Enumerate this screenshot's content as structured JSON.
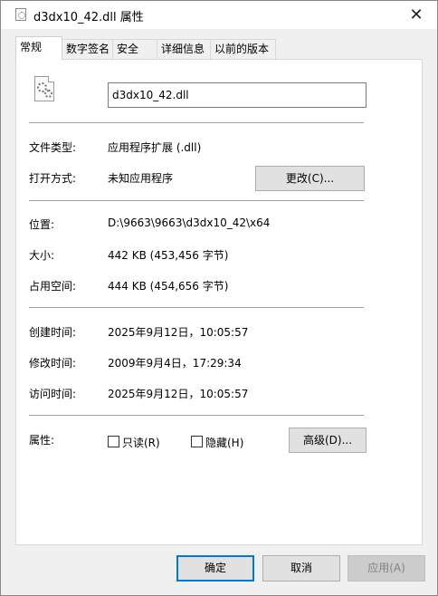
{
  "window": {
    "title": "d3dx10_42.dll 属性",
    "close_glyph": "✕"
  },
  "tabs": [
    {
      "label": "常规",
      "active": true
    },
    {
      "label": "数字签名",
      "active": false
    },
    {
      "label": "安全",
      "active": false
    },
    {
      "label": "详细信息",
      "active": false
    },
    {
      "label": "以前的版本",
      "active": false
    }
  ],
  "general": {
    "file_icon": "dll-gear-file-icon",
    "file_name": "d3dx10_42.dll",
    "file_type_label": "文件类型:",
    "file_type_value": "应用程序扩展 (.dll)",
    "opens_with_label": "打开方式:",
    "opens_with_value": "未知应用程序",
    "change_button": "更改(C)...",
    "location_label": "位置:",
    "location_value": "D:\\9663\\9663\\d3dx10_42\\x64",
    "size_label": "大小:",
    "size_value": "442 KB (453,456 字节)",
    "size_on_disk_label": "占用空间:",
    "size_on_disk_value": "444 KB (454,656 字节)",
    "created_label": "创建时间:",
    "created_value": "2025年9月12日，10:05:57",
    "modified_label": "修改时间:",
    "modified_value": "2009年9月4日，17:29:34",
    "accessed_label": "访问时间:",
    "accessed_value": "2025年9月12日，10:05:57",
    "attributes_label": "属性:",
    "readonly_label": "只读(R)",
    "readonly_checked": false,
    "hidden_label": "隐藏(H)",
    "hidden_checked": false,
    "advanced_button": "高级(D)..."
  },
  "footer": {
    "ok_button": "确定",
    "cancel_button": "取消",
    "apply_button": "应用(A)"
  },
  "colors": {
    "focus_border": "#0078d7",
    "button_bg": "#e1e1e1",
    "disabled_text": "#838383"
  }
}
